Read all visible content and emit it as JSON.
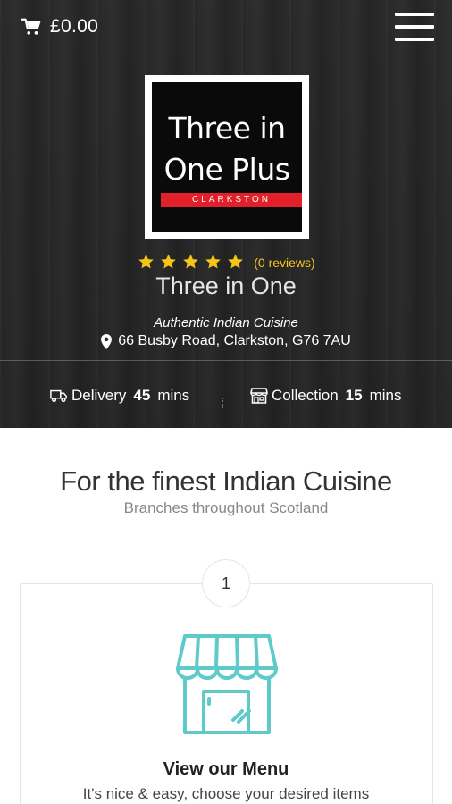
{
  "header": {
    "cart_total": "£0.00"
  },
  "logo": {
    "line1": "Three in",
    "line2": "One Plus",
    "location": "CLARKSTON"
  },
  "rating": {
    "stars": 5,
    "reviews_text": "(0 reviews)"
  },
  "restaurant": {
    "name": "Three in One",
    "tagline": "Authentic Indian Cuisine",
    "address": "66 Busby Road, Clarkston, G76 7AU"
  },
  "services": {
    "delivery": {
      "label": "Delivery",
      "time": "45",
      "unit": "mins"
    },
    "collection": {
      "label": "Collection",
      "time": "15",
      "unit": "mins"
    }
  },
  "intro": {
    "title": "For the finest Indian Cuisine",
    "subtitle": "Branches throughout Scotland"
  },
  "steps": [
    {
      "number": "1",
      "title": "View our Menu",
      "description": "It's nice & easy, choose your desired items"
    }
  ],
  "colors": {
    "star": "#f5c518",
    "logo_bar": "#e2202a",
    "shop_icon": "#5fcaca"
  }
}
